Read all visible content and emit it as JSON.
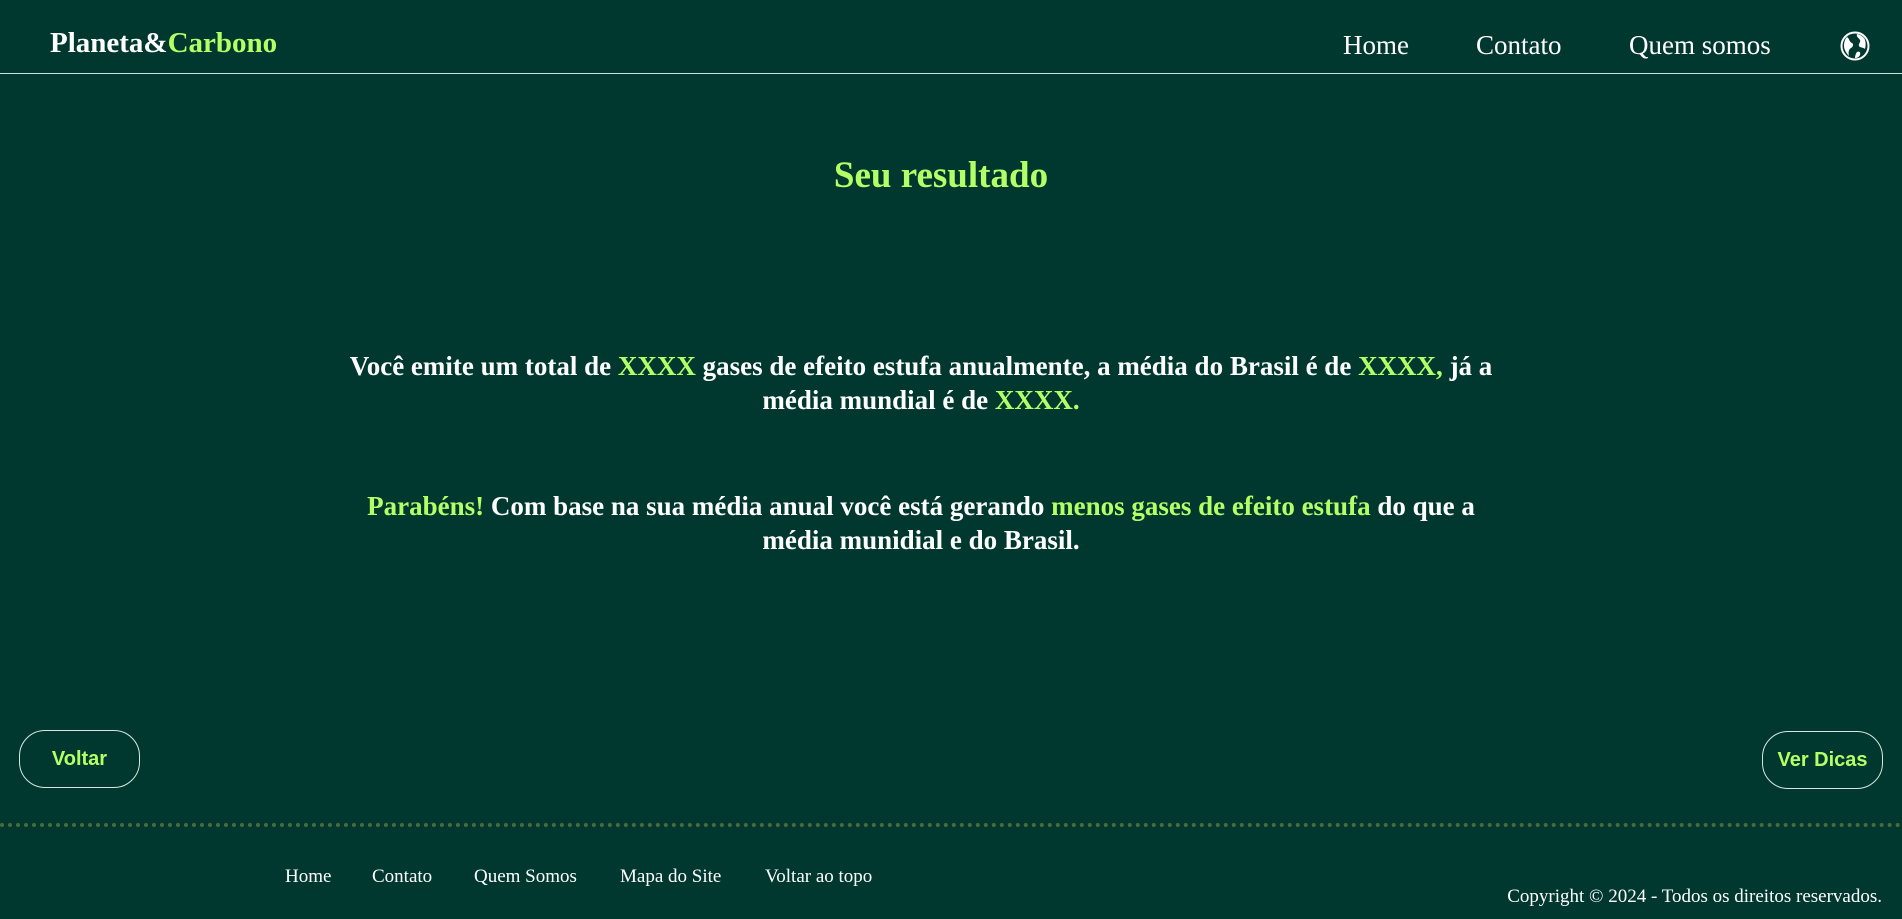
{
  "header": {
    "brand_part1": "Planeta&",
    "brand_part2": "Carbono",
    "nav": {
      "home": "Home",
      "contact": "Contato",
      "about": "Quem somos"
    },
    "globe_icon": "globe-icon"
  },
  "main": {
    "title": "Seu resultado",
    "emissions": {
      "t1": "Você emite um total de ",
      "v1": "XXXX",
      "t2": " gases de efeito estufa anualmente, a média do Brasil é de ",
      "v2": "XXXX,",
      "t3": " já a média mundial é de ",
      "v3": "XXXX."
    },
    "verdict": {
      "congrats": "Parabéns!",
      "t1": " Com base na sua média anual você está gerando ",
      "highlight": "menos gases de efeito estufa",
      "t2": " do que a média munidial e do Brasil."
    }
  },
  "buttons": {
    "back": "Voltar",
    "tips": "Ver Dicas"
  },
  "footer": {
    "links": {
      "home": "Home",
      "contact": "Contato",
      "about": "Quem Somos",
      "sitemap": "Mapa do Site",
      "top": "Voltar ao topo"
    },
    "copyright": "Copyright © 2024 - Todos os direitos reservados."
  },
  "colors": {
    "background": "#003830",
    "accent": "#b3ff66",
    "text": "#ffffff"
  }
}
